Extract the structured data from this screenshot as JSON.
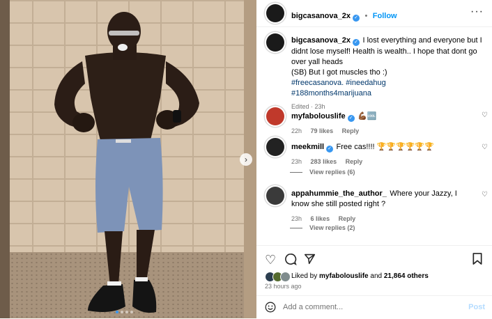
{
  "post": {
    "username": "bigcasanova_2x",
    "follow_label": "Follow",
    "more_icon": "more-dots-icon",
    "caption_lines": [
      "I lost everything and everyone but I didnt lose myself! Health is wealth.. I hope that dont go over yall heads",
      "(SB) But I got muscles tho :)"
    ],
    "hashtags": [
      "#freecasanova. #ineedahug",
      "#188months4marijuana"
    ],
    "edited_meta": "Edited · 23h",
    "liked_by_prefix": "Liked by",
    "liked_by_user": "myfabolouslife",
    "liked_by_suffix": "and",
    "likes_others": "21,864 others",
    "time_ago": "23 hours ago",
    "comment_placeholder": "Add a comment...",
    "post_label": "Post"
  },
  "comments": [
    {
      "username": "myfabolouslife",
      "text": "💪🏾🆒",
      "time": "22h",
      "likes": "79 likes",
      "reply": "Reply",
      "verified": true
    },
    {
      "username": "meekmill",
      "text": "Free cas!!!! 🏆🏆🏆🏆🏆🏆",
      "time": "23h",
      "likes": "283 likes",
      "reply": "Reply",
      "verified": true,
      "view_replies": "View replies (6)"
    },
    {
      "username": "appahummie_the_author_",
      "text": "Where your Jazzy, I know she still posted right ?",
      "time": "23h",
      "likes": "6 likes",
      "reply": "Reply",
      "verified": false,
      "view_replies": "View replies (2)"
    }
  ],
  "colors": {
    "accent": "#3897f0",
    "link": "#00376b",
    "muted": "#737373"
  }
}
